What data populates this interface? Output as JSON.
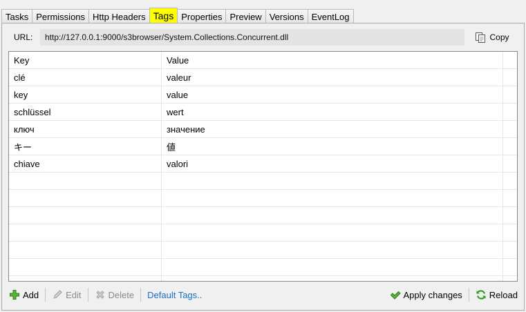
{
  "tabs": [
    {
      "label": "Tasks",
      "active": false
    },
    {
      "label": "Permissions",
      "active": false
    },
    {
      "label": "Http Headers",
      "active": false
    },
    {
      "label": "Tags",
      "active": true
    },
    {
      "label": "Properties",
      "active": false
    },
    {
      "label": "Preview",
      "active": false
    },
    {
      "label": "Versions",
      "active": false
    },
    {
      "label": "EventLog",
      "active": false
    }
  ],
  "url": {
    "label": "URL:",
    "value": "http://127.0.0.1:9000/s3browser/System.Collections.Concurrent.dll",
    "copy_label": "Copy"
  },
  "grid": {
    "columns": [
      "Key",
      "Value"
    ],
    "rows": [
      [
        "clé",
        "valeur"
      ],
      [
        "key",
        "value"
      ],
      [
        "schlüssel",
        "wert"
      ],
      [
        "ключ",
        "значение"
      ],
      [
        "キー",
        "値"
      ],
      [
        "chiave",
        "valori"
      ]
    ]
  },
  "toolbar": {
    "add": "Add",
    "edit": "Edit",
    "delete": "Delete",
    "default_tags": "Default Tags..",
    "apply": "Apply changes",
    "reload": "Reload"
  },
  "icons": {
    "add": "plus-icon",
    "edit": "pencil-icon",
    "delete": "delete-x-icon",
    "apply": "checkmark-icon",
    "reload": "reload-icon",
    "copy": "copy-icon"
  },
  "colors": {
    "active_tab": "#ffff00",
    "link": "#1a6fc4"
  }
}
